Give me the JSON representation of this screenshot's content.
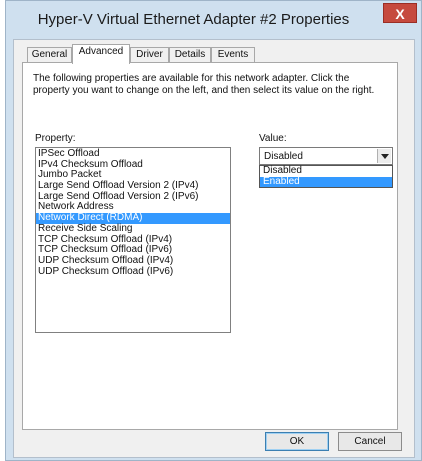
{
  "window": {
    "title": "Hyper-V Virtual Ethernet Adapter #2 Properties",
    "close_label": "X"
  },
  "tabs": [
    "General",
    "Advanced",
    "Driver",
    "Details",
    "Events"
  ],
  "active_tab": "Advanced",
  "advanced": {
    "description": "The following properties are available for this network adapter. Click the property you want to change on the left, and then select its value on the right.",
    "property_label": "Property:",
    "value_label": "Value:",
    "properties": [
      "IPSec Offload",
      "IPv4 Checksum Offload",
      "Jumbo Packet",
      "Large Send Offload Version 2 (IPv4)",
      "Large Send Offload Version 2 (IPv6)",
      "Network Address",
      "Network Direct (RDMA)",
      "Receive Side Scaling",
      "TCP Checksum Offload (IPv4)",
      "TCP Checksum Offload (IPv6)",
      "UDP Checksum Offload (IPv4)",
      "UDP Checksum Offload (IPv6)"
    ],
    "selected_property": "Network Direct (RDMA)",
    "value_selected": "Disabled",
    "value_options": [
      "Disabled",
      "Enabled"
    ],
    "highlighted_option": "Enabled"
  },
  "buttons": {
    "ok": "OK",
    "cancel": "Cancel"
  },
  "colors": {
    "selection": "#3399ff",
    "close": "#c64a3e",
    "frame": "#cfe0ef"
  }
}
